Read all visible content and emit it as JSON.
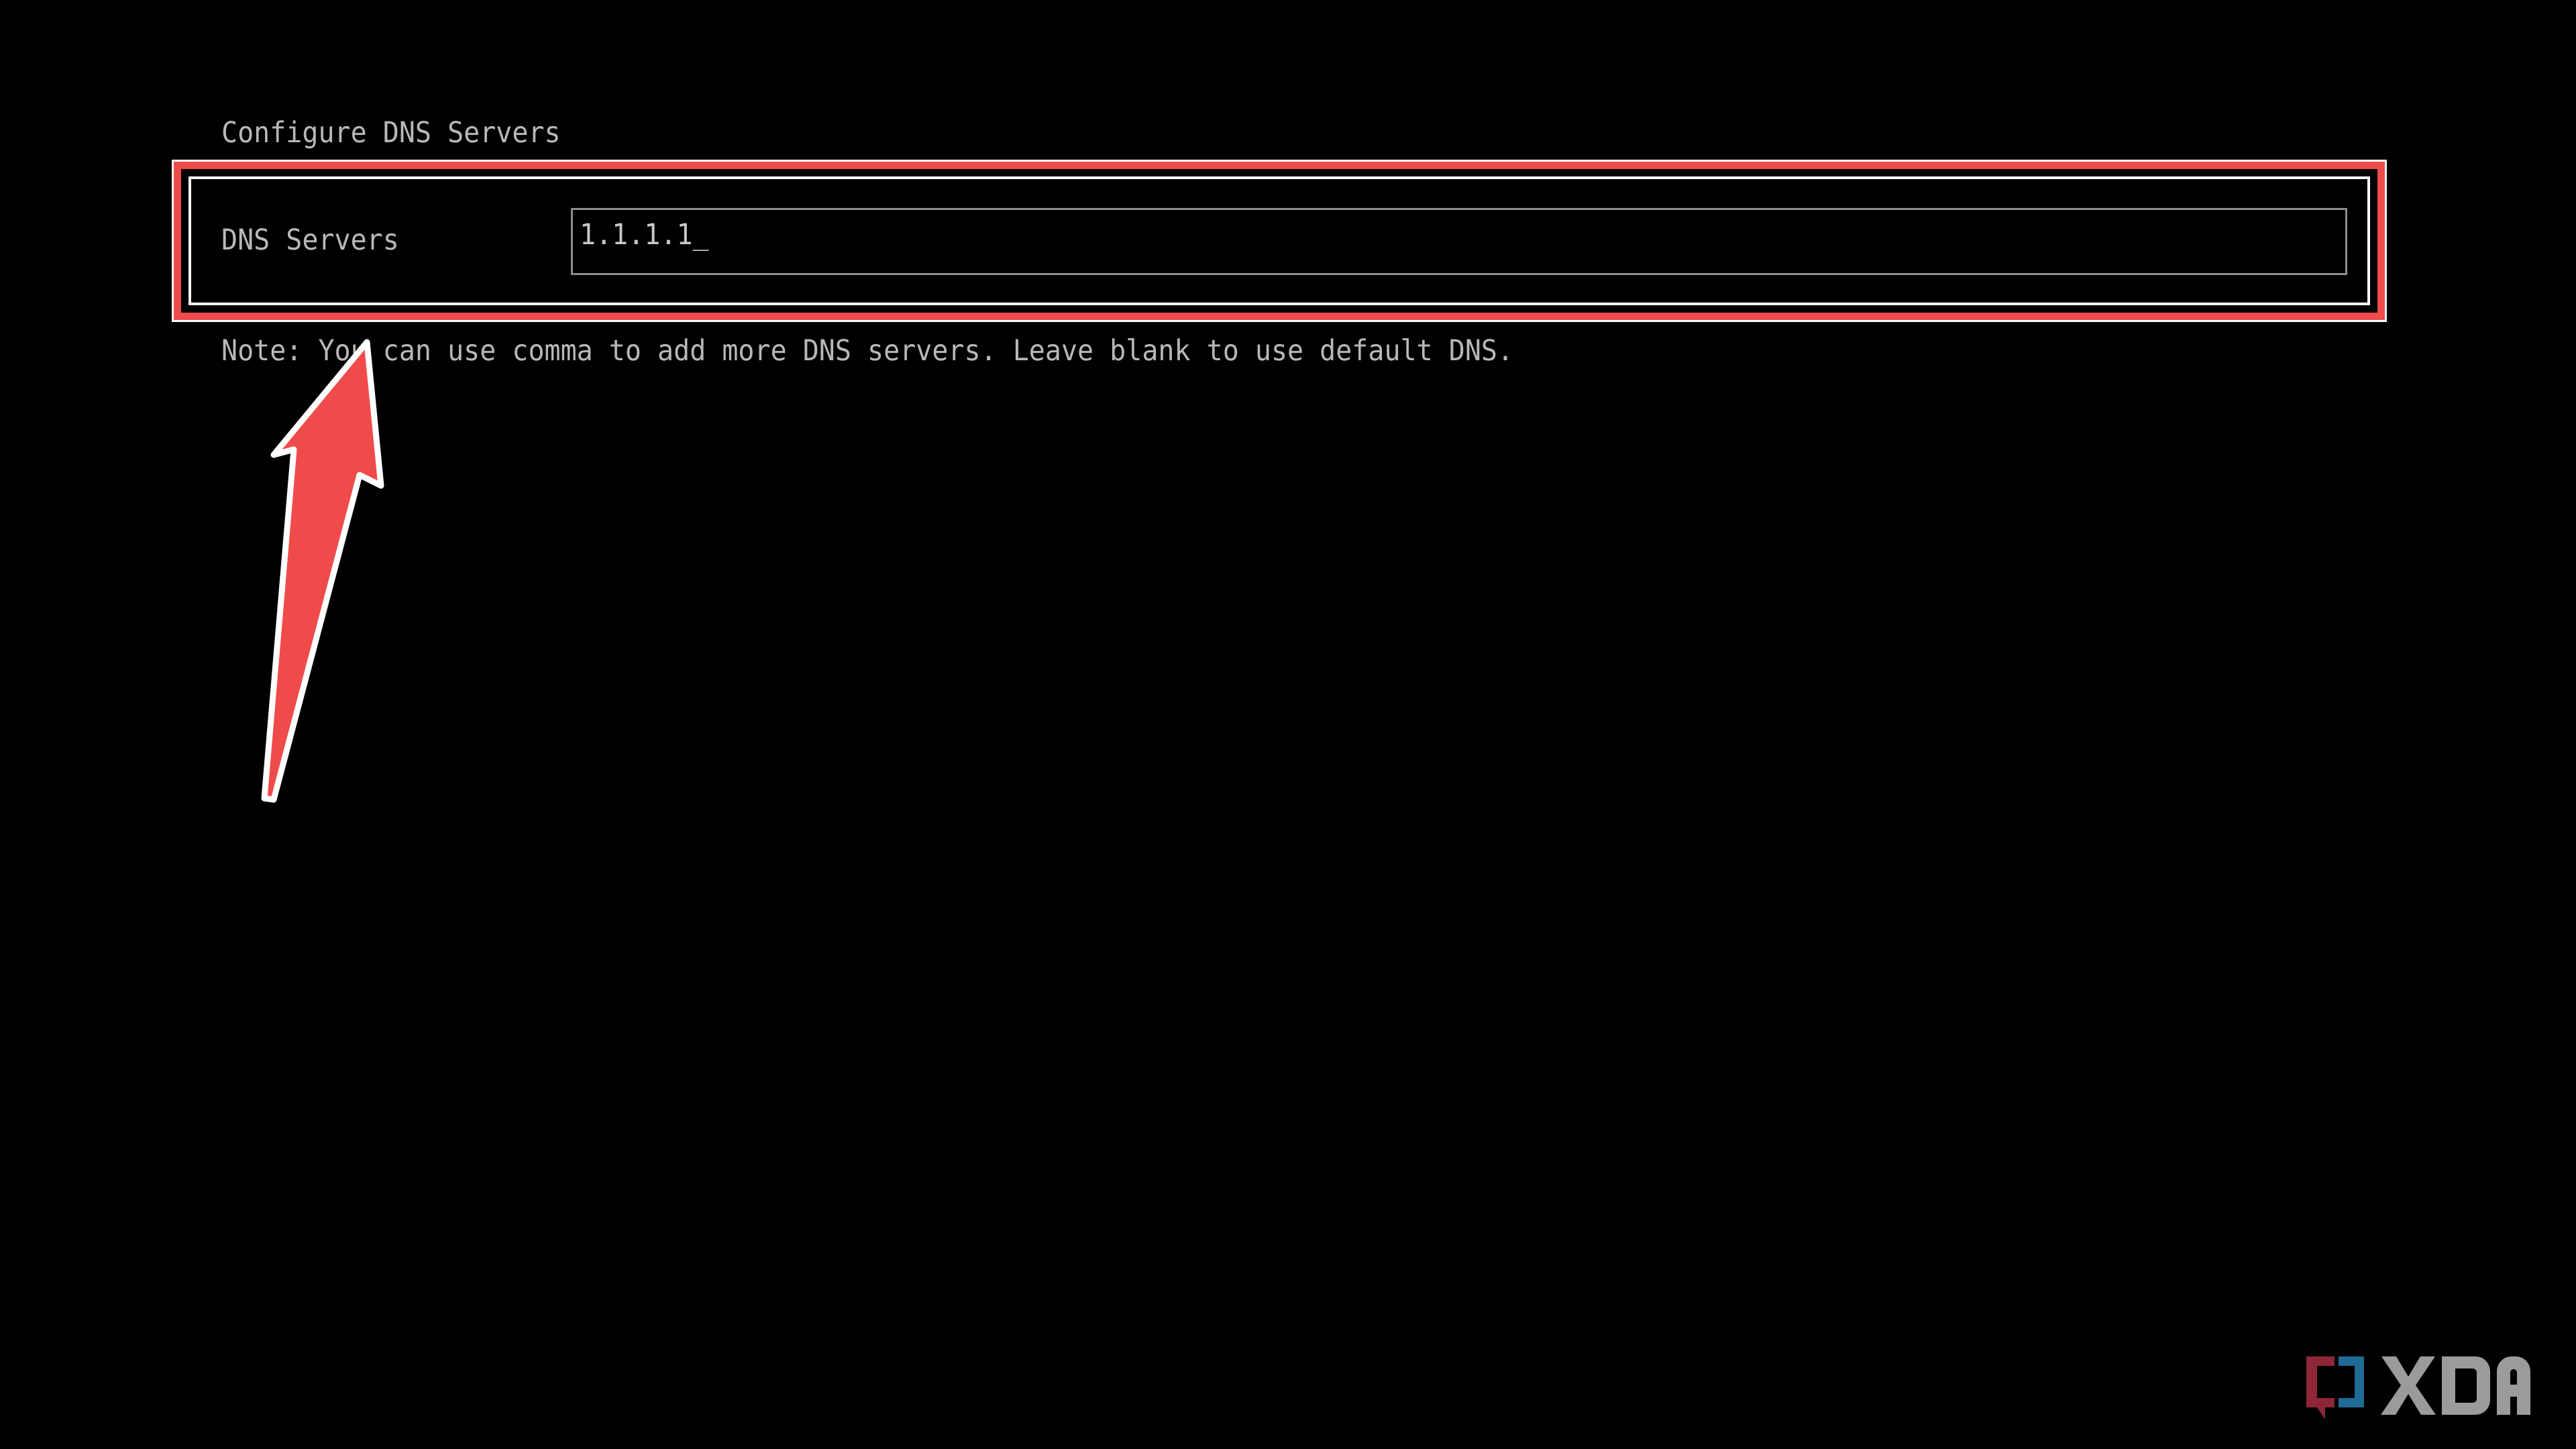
{
  "screen": {
    "background_color": "#000000",
    "text_color": "#b8b8b8"
  },
  "page_title": "Configure DNS Servers",
  "form": {
    "dns_servers_label": "DNS Servers",
    "dns_servers_value": "1.1.1.1",
    "dns_servers_caret": "_",
    "dns_servers_placeholder": "",
    "note": "Note: You can use comma to add more DNS servers. Leave blank to use default DNS."
  },
  "annotations": {
    "highlight_rect": {
      "name": "dns-servers-field-highlight",
      "border_color": "#ef4b4b",
      "outline_color": "#ffffff"
    },
    "arrow": {
      "name": "pointer-arrow",
      "fill_color": "#ef4b4b",
      "outline_color": "#ffffff",
      "points_to": "Note: You can use comma to add more DNS servers."
    }
  },
  "watermark": {
    "brand": "XDA",
    "bracket_left_color": "#8e2638",
    "bracket_right_color": "#1f6b96",
    "wordmark_color": "#9b9b9b"
  }
}
